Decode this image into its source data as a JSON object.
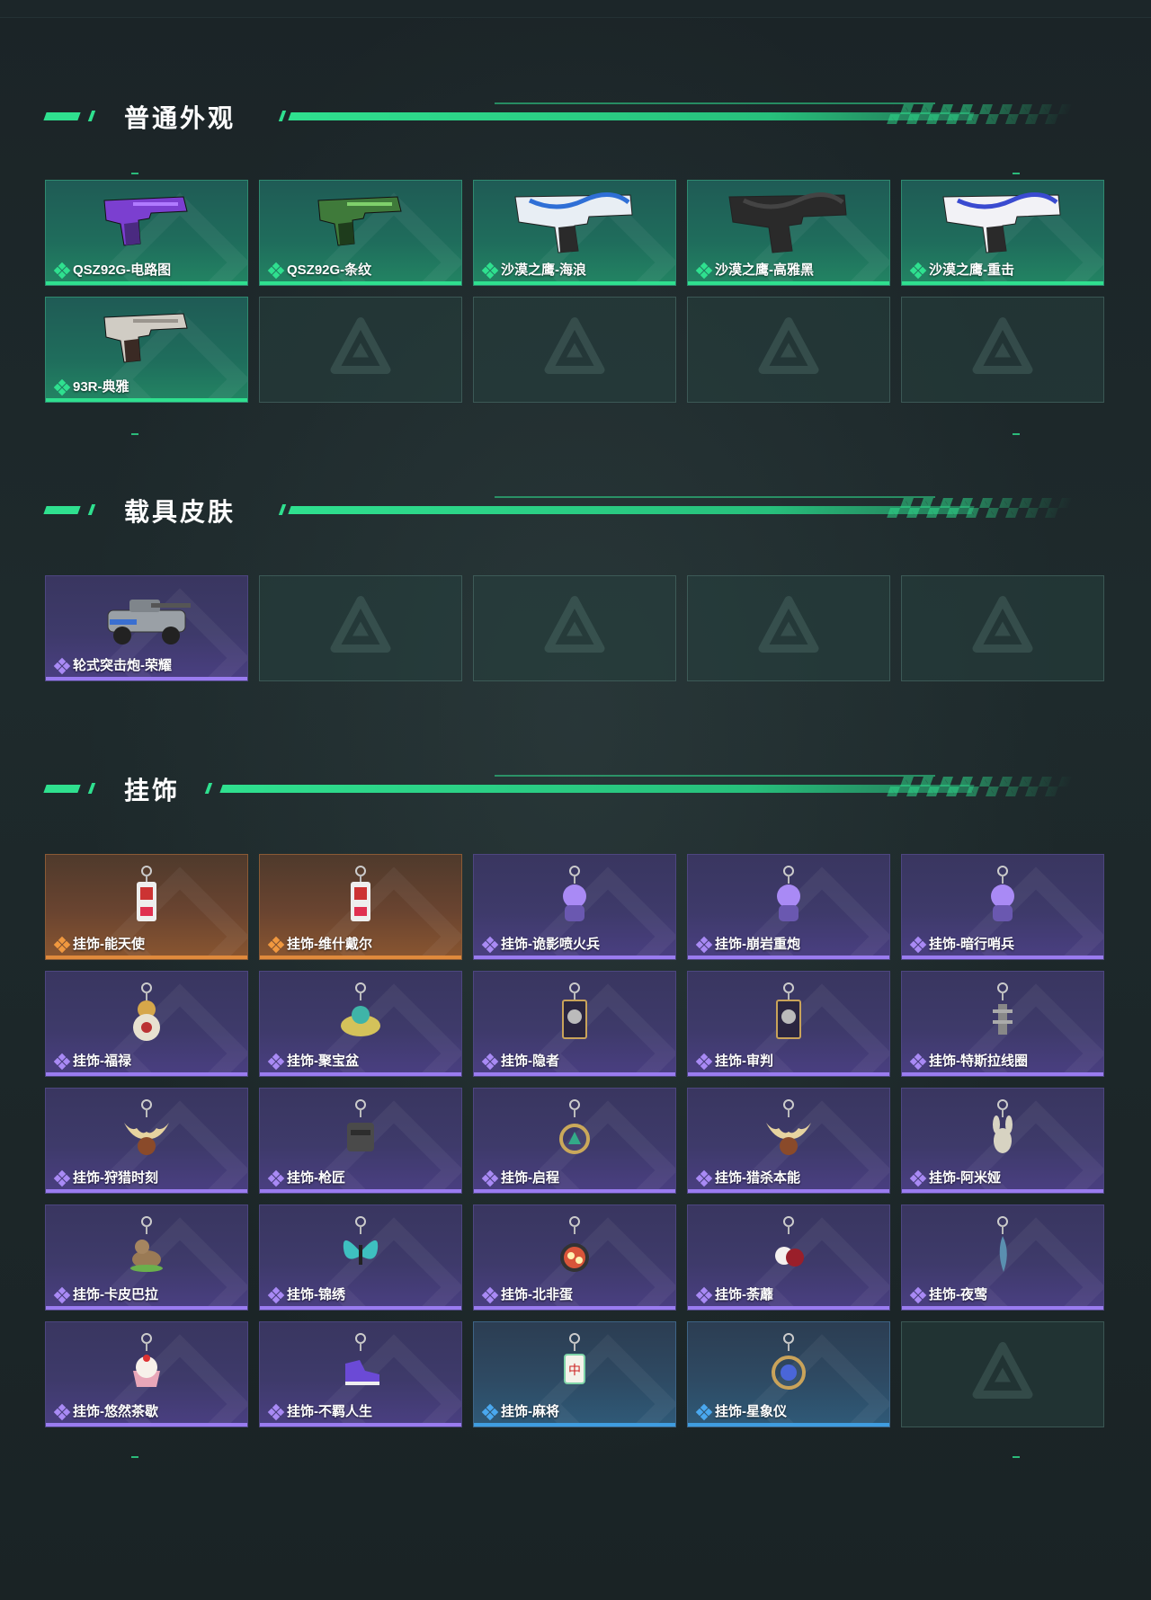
{
  "sections": [
    {
      "title": "普通外观",
      "items": [
        {
          "label": "QSZ92G-电路图",
          "rarity": "green",
          "icon": "pistol-purple-icon"
        },
        {
          "label": "QSZ92G-条纹",
          "rarity": "green",
          "icon": "pistol-green-icon"
        },
        {
          "label": "沙漠之鹰-海浪",
          "rarity": "green",
          "icon": "desert-eagle-wave-icon"
        },
        {
          "label": "沙漠之鹰-高雅黑",
          "rarity": "green",
          "icon": "desert-eagle-black-icon"
        },
        {
          "label": "沙漠之鹰-重击",
          "rarity": "green",
          "icon": "desert-eagle-strike-icon"
        },
        {
          "label": "93R-典雅",
          "rarity": "green",
          "icon": "pistol-93r-icon"
        }
      ],
      "empty_slots": 4
    },
    {
      "title": "载具皮肤",
      "items": [
        {
          "label": "轮式突击炮-荣耀",
          "rarity": "purple",
          "icon": "armored-vehicle-icon"
        }
      ],
      "empty_slots": 4
    },
    {
      "title": "挂饰",
      "items": [
        {
          "label": "挂饰-能天使",
          "rarity": "orange",
          "icon": "charm-tag-icon"
        },
        {
          "label": "挂饰-维什戴尔",
          "rarity": "orange",
          "icon": "charm-tag-icon"
        },
        {
          "label": "挂饰-诡影喷火兵",
          "rarity": "purple",
          "icon": "charm-figure-icon"
        },
        {
          "label": "挂饰-崩岩重炮",
          "rarity": "purple",
          "icon": "charm-figure-icon"
        },
        {
          "label": "挂饰-暗行哨兵",
          "rarity": "purple",
          "icon": "charm-figure-icon"
        },
        {
          "label": "挂饰-福禄",
          "rarity": "purple",
          "icon": "charm-gourd-icon"
        },
        {
          "label": "挂饰-聚宝盆",
          "rarity": "purple",
          "icon": "charm-treasure-icon"
        },
        {
          "label": "挂饰-隐者",
          "rarity": "purple",
          "icon": "charm-card-icon"
        },
        {
          "label": "挂饰-审判",
          "rarity": "purple",
          "icon": "charm-card-icon"
        },
        {
          "label": "挂饰-特斯拉线圈",
          "rarity": "purple",
          "icon": "charm-coil-icon"
        },
        {
          "label": "挂饰-狩猎时刻",
          "rarity": "purple",
          "icon": "charm-antlers-icon"
        },
        {
          "label": "挂饰-枪匠",
          "rarity": "purple",
          "icon": "charm-vest-icon"
        },
        {
          "label": "挂饰-启程",
          "rarity": "purple",
          "icon": "charm-ring-icon"
        },
        {
          "label": "挂饰-猎杀本能",
          "rarity": "purple",
          "icon": "charm-antlers-icon"
        },
        {
          "label": "挂饰-阿米娅",
          "rarity": "purple",
          "icon": "charm-bunny-icon"
        },
        {
          "label": "挂饰-卡皮巴拉",
          "rarity": "purple",
          "icon": "charm-capybara-icon"
        },
        {
          "label": "挂饰-锦绣",
          "rarity": "purple",
          "icon": "charm-butterfly-icon"
        },
        {
          "label": "挂饰-北非蛋",
          "rarity": "purple",
          "icon": "charm-pan-icon"
        },
        {
          "label": "挂饰-荼蘼",
          "rarity": "purple",
          "icon": "charm-flower-icon"
        },
        {
          "label": "挂饰-夜莺",
          "rarity": "purple",
          "icon": "charm-feather-icon"
        },
        {
          "label": "挂饰-悠然茶歇",
          "rarity": "purple",
          "icon": "charm-cupcake-icon"
        },
        {
          "label": "挂饰-不羁人生",
          "rarity": "purple",
          "icon": "charm-sneaker-icon"
        },
        {
          "label": "挂饰-麻将",
          "rarity": "blue",
          "icon": "charm-mahjong-icon"
        },
        {
          "label": "挂饰-星象仪",
          "rarity": "blue",
          "icon": "charm-astrolabe-icon"
        }
      ],
      "empty_slots": 1
    }
  ],
  "colors": {
    "accent": "#2fe08f",
    "green_rarity": "#2fe08f",
    "purple_rarity": "#9a7cf0",
    "orange_rarity": "#e08a3c",
    "blue_rarity": "#3f9de0",
    "background": "#1e2a2c"
  },
  "empty_slot_icon": "delta-logo-icon"
}
